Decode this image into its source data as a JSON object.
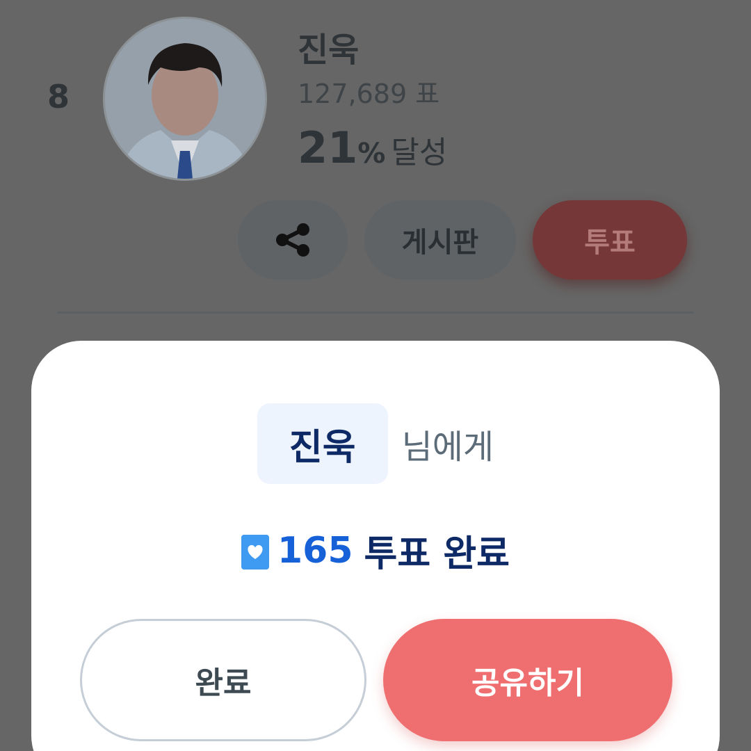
{
  "entry": {
    "rank": "8",
    "name": "진욱",
    "votes": "127,689 표",
    "percent": "21",
    "percent_sign": "%",
    "percent_label": "달성",
    "board_label": "게시판",
    "vote_label": "투표"
  },
  "modal": {
    "recipient_name": "진욱",
    "recipient_suffix": "님에게",
    "vote_count": "165",
    "vote_done_text": "투표 완료",
    "done_label": "완료",
    "share_label": "공유하기"
  },
  "colors": {
    "vote_button": "#ef6f71",
    "vote_count": "#1661d8",
    "name_navy": "#0e2a66",
    "overlay": "#666666"
  },
  "icons": {
    "share": "share-icon",
    "heart": "heart-icon"
  }
}
